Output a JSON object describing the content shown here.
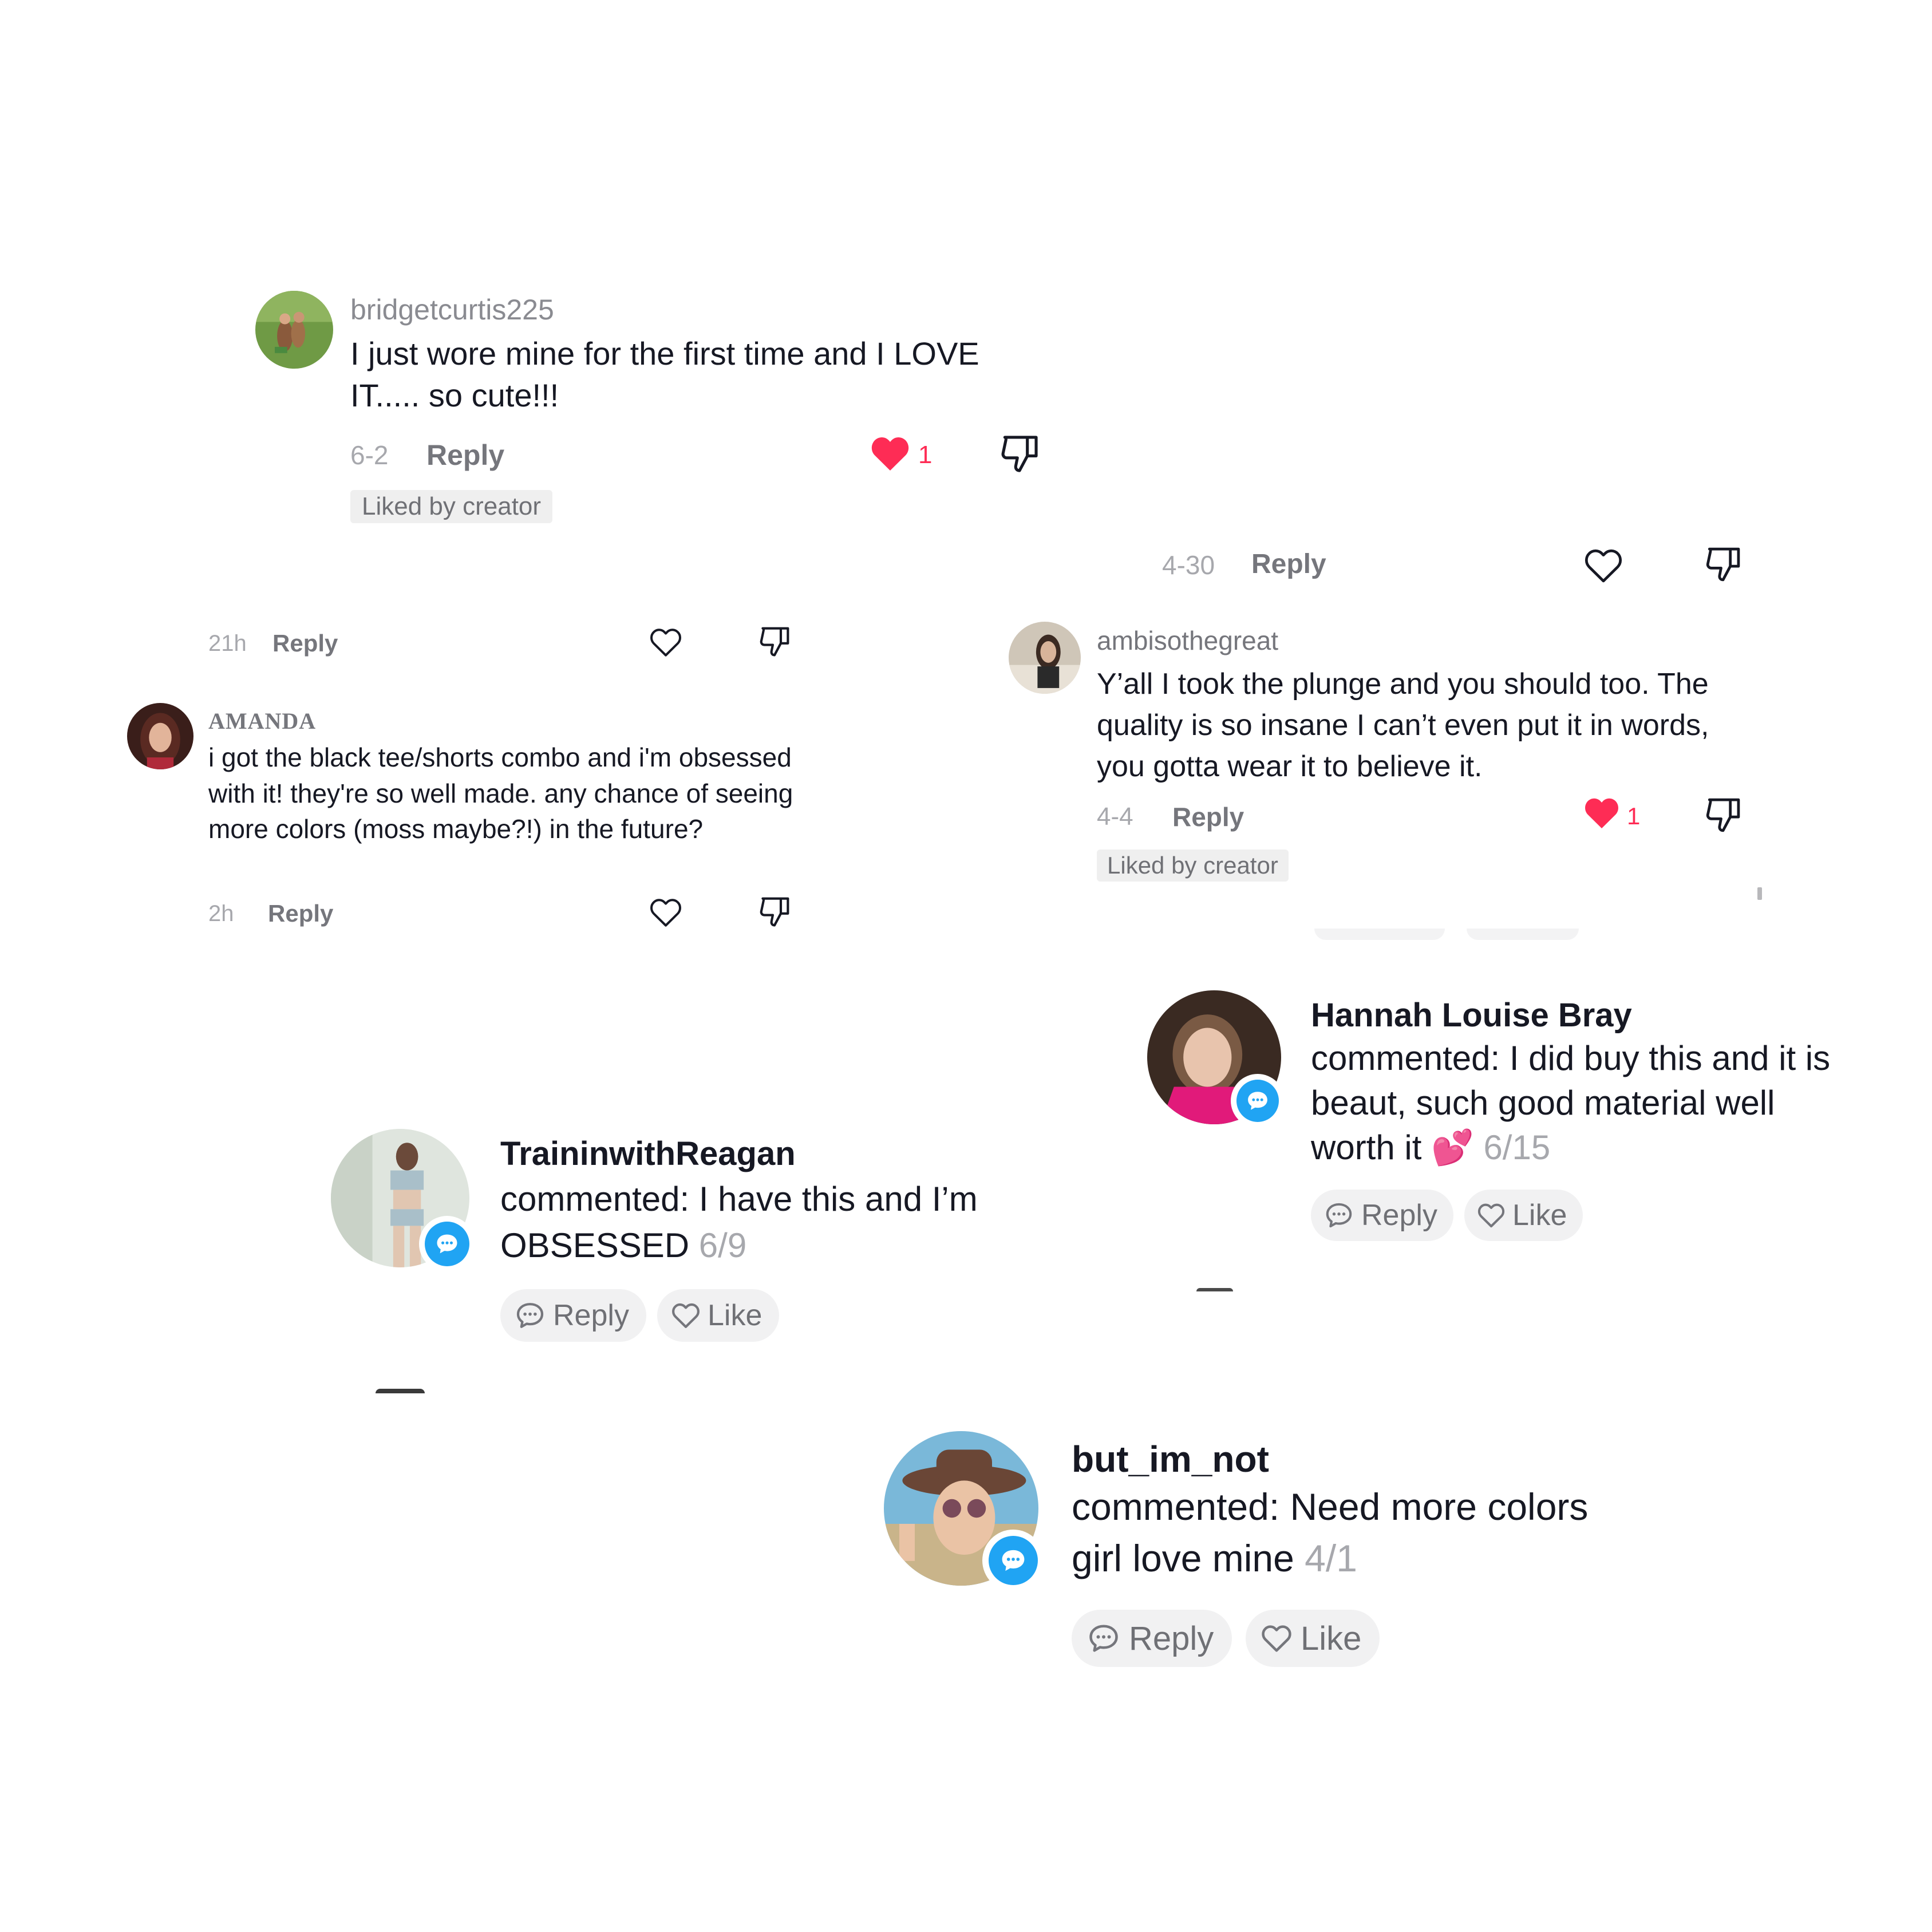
{
  "comments": [
    {
      "username": "bridgetcurtis225",
      "text": "I just wore mine for the first time and I LOVE IT..... so cute!!!",
      "time": "6-2",
      "reply": "Reply",
      "likes": "1",
      "badge": "Liked by creator"
    },
    {
      "time": "4-30",
      "reply": "Reply"
    },
    {
      "time": "21h",
      "reply": "Reply"
    },
    {
      "username": "AMANDA",
      "text": "i got the black tee/shorts combo and i'm obsessed with it! they're so well made. any chance of seeing more colors (moss maybe?!) in the future?",
      "time": "2h",
      "reply": "Reply"
    },
    {
      "username": "ambisothegreat",
      "text": "Y’all I took the plunge and you should too. The quality is so insane I can’t even put it in words, you gotta wear it to believe it.",
      "time": "4-4",
      "reply": "Reply",
      "likes": "1",
      "badge": "Liked by creator"
    }
  ],
  "notifications": [
    {
      "name": "Hannah Louise Bray",
      "text": "commented: I did buy this and it is beaut, such good material well worth it 💕",
      "date": "6/15",
      "reply": "Reply",
      "like": "Like"
    },
    {
      "name": "TraininwithReagan",
      "text": "commented: I have this and I’m OBSESSED",
      "date": "6/9",
      "reply": "Reply",
      "like": "Like"
    },
    {
      "name": "but_im_not",
      "text": "commented: Need more colors girl love mine",
      "date": "4/1",
      "reply": "Reply",
      "like": "Like"
    }
  ],
  "colors": {
    "heart_filled": "#fe2c55",
    "badge_blue": "#20a4f3",
    "pill_bg": "#f1f1f2"
  },
  "icons": [
    "heart-outline-icon",
    "heart-filled-icon",
    "thumbs-down-icon",
    "comment-bubble-icon",
    "speech-bubble-badge-icon"
  ]
}
